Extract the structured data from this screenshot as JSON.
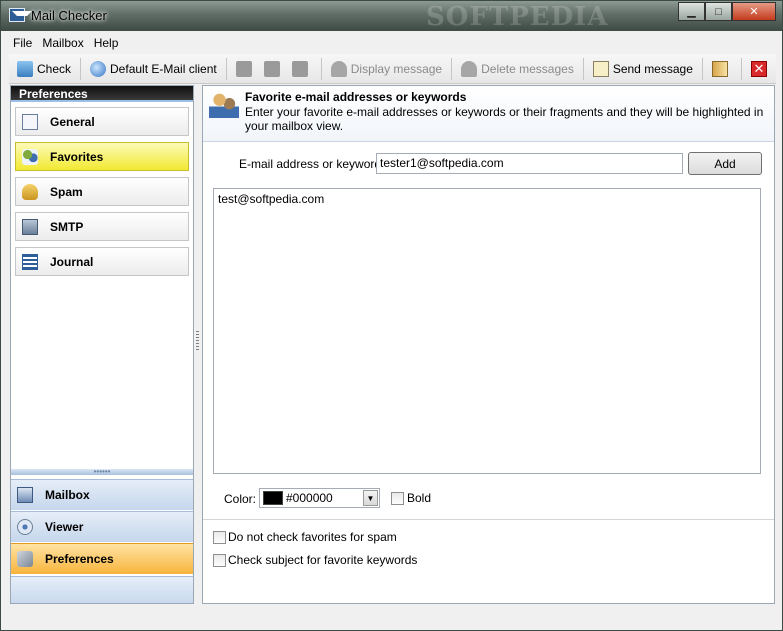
{
  "window": {
    "title": "Mail Checker",
    "watermark": "SOFTPEDIA"
  },
  "menu": [
    "File",
    "Mailbox",
    "Help"
  ],
  "toolbar": {
    "check": "Check",
    "default_client": "Default E-Mail client",
    "display_message": "Display message",
    "delete_messages": "Delete messages",
    "send_message": "Send message"
  },
  "sidebar": {
    "header": "Preferences",
    "items": [
      {
        "label": "General",
        "icon": "document-icon"
      },
      {
        "label": "Favorites",
        "icon": "people-icon",
        "active": true
      },
      {
        "label": "Spam",
        "icon": "can-icon"
      },
      {
        "label": "SMTP",
        "icon": "server-icon"
      },
      {
        "label": "Journal",
        "icon": "list-icon"
      }
    ],
    "bottom_items": [
      {
        "label": "Mailbox",
        "icon": "mailbox-icon"
      },
      {
        "label": "Viewer",
        "icon": "viewer-icon"
      },
      {
        "label": "Preferences",
        "icon": "preferences-icon",
        "active": true
      }
    ]
  },
  "panel": {
    "title": "Favorite e-mail addresses or keywords",
    "description": "Enter your favorite e-mail addresses or keywords or their fragments and they will be highlighted in your mailbox view.",
    "field_label": "E-mail address or keyword:",
    "field_value": "tester1@softpedia.com",
    "add_label": "Add",
    "list": [
      "test@softpedia.com"
    ],
    "color_label": "Color:",
    "color_value": "#000000",
    "bold_label": "Bold",
    "opt_spam": "Do not check favorites for spam",
    "opt_subject": "Check subject for favorite keywords"
  },
  "colors": {
    "active_nav": "#f2e932",
    "active_bottom": "#f7b43b",
    "selected_swatch": "#000000"
  }
}
